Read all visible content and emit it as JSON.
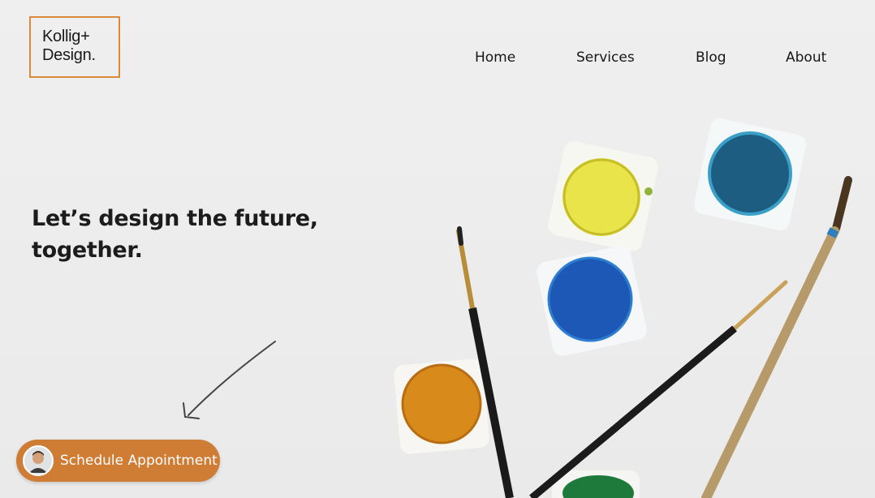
{
  "brand": {
    "line1": "Kollig+",
    "line2": "Design."
  },
  "nav": [
    {
      "label": "Home"
    },
    {
      "label": "Services"
    },
    {
      "label": "Blog"
    },
    {
      "label": "About"
    }
  ],
  "hero": {
    "line1": "Let’s design the future,",
    "line2": "together."
  },
  "cta": {
    "label": "Schedule Appointment"
  },
  "colors": {
    "accent": "#cf7c34",
    "logo_border": "#d98a3a"
  },
  "icons": [
    "arrow-icon",
    "avatar"
  ]
}
